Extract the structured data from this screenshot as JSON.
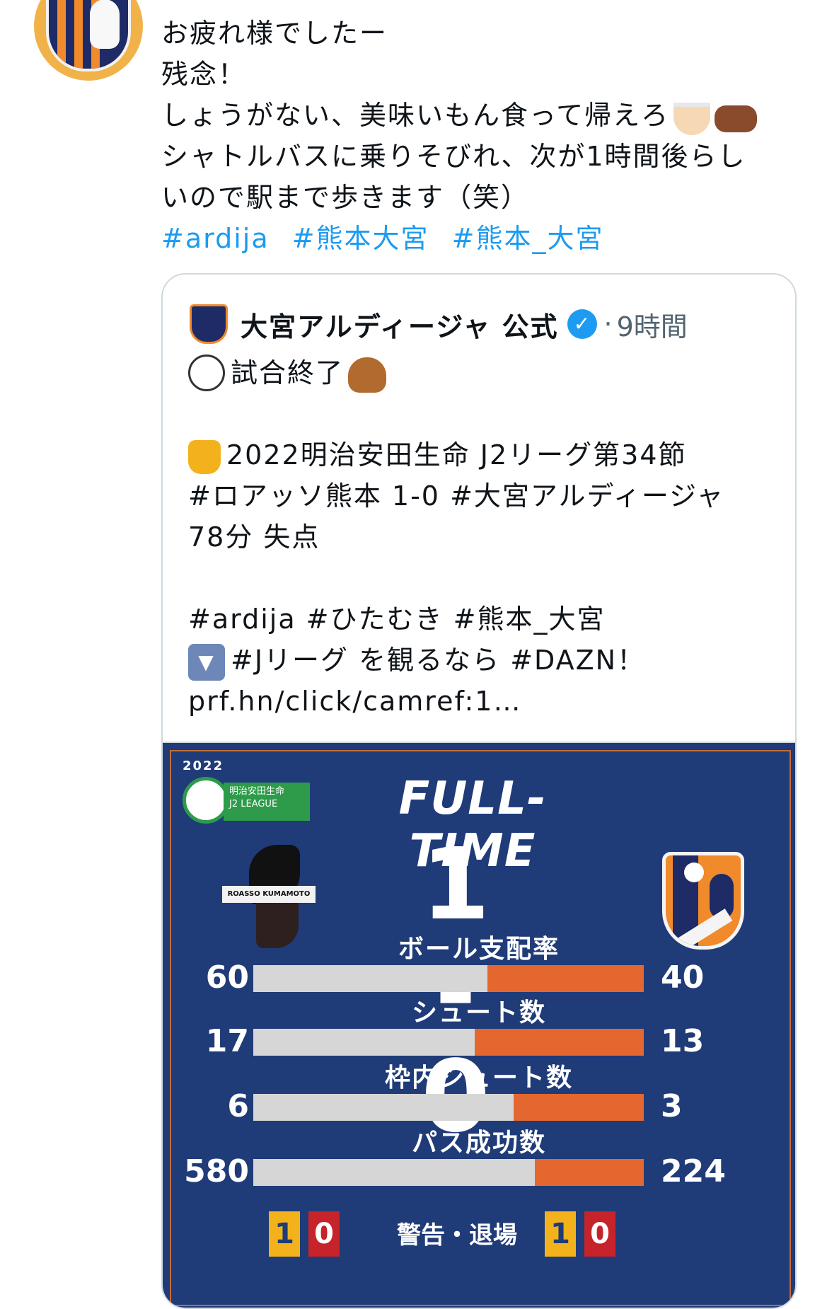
{
  "tweet": {
    "lines": [
      "お疲れ様でしたー",
      "残念！",
      "しょうがない、美味いもん食って帰えろ",
      "シャトルバスに乗りそびれ、次が1時間後らし",
      "いので駅まで歩きます（笑）"
    ],
    "hashtags": [
      "#ardija",
      "#熊本大宮",
      "#熊本_大宮"
    ],
    "emoji_icons": [
      "ramen-icon",
      "cow-icon"
    ]
  },
  "quote": {
    "name": "大宮アルディージャ 公式",
    "time": "9時間",
    "separator": "·",
    "verified_icon": "verified-badge-icon",
    "lines": [
      "試合終了",
      "",
      "2022明治安田生命 J2リーグ第34節",
      "#ロアッソ熊本 1-0 #大宮アルディージャ",
      "78分 失点",
      "",
      "#ardija #ひたむき #熊本_大宮",
      "#Jリーグ を観るなら #DAZN！",
      "prf.hn/click/camref:1…"
    ]
  },
  "graphic": {
    "year": "2022",
    "league_line1": "明治安田生命",
    "league_line2": "J2 LEAGUE",
    "headline": "FULL-TIME",
    "score": "1 - 0",
    "left_team_banner": "ROASSO KUMAMOTO",
    "stats": [
      {
        "title": "ボール支配率",
        "left": "60",
        "right": "40",
        "right_share": 0.4
      },
      {
        "title": "シュート数",
        "left": "17",
        "right": "13",
        "right_share": 0.4333
      },
      {
        "title": "枠内シュート数",
        "left": "6",
        "right": "3",
        "right_share": 0.3333
      },
      {
        "title": "パス成功数",
        "left": "580",
        "right": "224",
        "right_share": 0.2786
      }
    ],
    "cards": {
      "label": "警告・退場",
      "left_yellow": "1",
      "left_red": "0",
      "right_yellow": "1",
      "right_red": "0"
    }
  },
  "colors": {
    "link": "#1d9bf0",
    "graphic_bg": "#1f3b78",
    "stat_orange": "#e56730",
    "stat_grey": "#d6d6d6"
  }
}
